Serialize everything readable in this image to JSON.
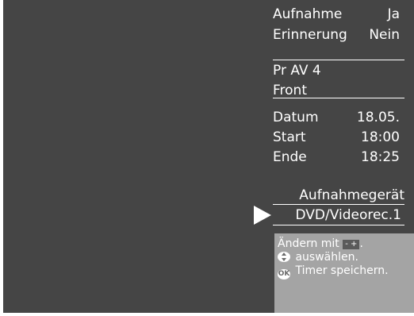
{
  "menu": {
    "aufnahme_label": "Aufnahme",
    "aufnahme_value": "Ja",
    "erinnerung_label": "Erinnerung",
    "erinnerung_value": "Nein",
    "program": "Pr  AV 4",
    "source": "Front",
    "datum_label": "Datum",
    "datum_value": "18.05.",
    "start_label": "Start",
    "start_value": "18:00",
    "ende_label": "Ende",
    "ende_value": "18:25",
    "device_heading": "Aufnahmegerät",
    "device_value": "DVD/Videorec.1"
  },
  "help": {
    "line1_prefix": "Ändern mit",
    "key_label": "- +",
    "line1_suffix": ".",
    "line2": "auswählen.",
    "ok_key": "OK",
    "line3": "Timer speichern."
  },
  "colors": {
    "screen_bg": "#454545",
    "help_bg": "#a4a4a4",
    "text": "#ffffff"
  }
}
